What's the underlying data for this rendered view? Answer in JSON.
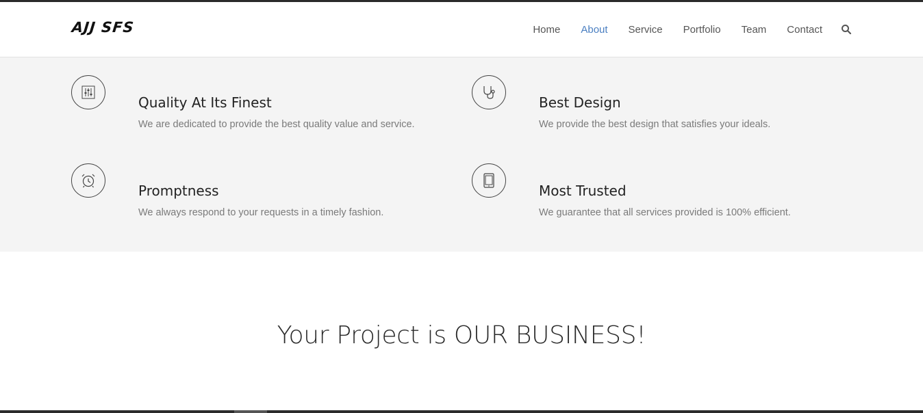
{
  "brand": {
    "logo_text": "AJJ SFS"
  },
  "nav": {
    "items": [
      {
        "label": "Home"
      },
      {
        "label": "About"
      },
      {
        "label": "Service"
      },
      {
        "label": "Portfolio"
      },
      {
        "label": "Team"
      },
      {
        "label": "Contact"
      }
    ],
    "active": "About",
    "active_color": "#4a7fc1",
    "search_icon": "search-icon"
  },
  "features": [
    {
      "icon": "sliders-icon",
      "title": "Quality At Its Finest",
      "desc": "We are dedicated to provide the best quality value and service."
    },
    {
      "icon": "stethoscope-icon",
      "title": "Best Design",
      "desc": "We provide the best design that satisfies your ideals."
    },
    {
      "icon": "alarm-clock-icon",
      "title": "Promptness",
      "desc": "We always respond to your requests in a timely fashion."
    },
    {
      "icon": "tablet-icon",
      "title": "Most Trusted",
      "desc": "We guarantee that all services provided is 100% efficient."
    }
  ],
  "tagline": "Your Project is OUR BUSINESS!",
  "colors": {
    "section_bg": "#f4f4f4",
    "accent": "#4a7fc1"
  }
}
